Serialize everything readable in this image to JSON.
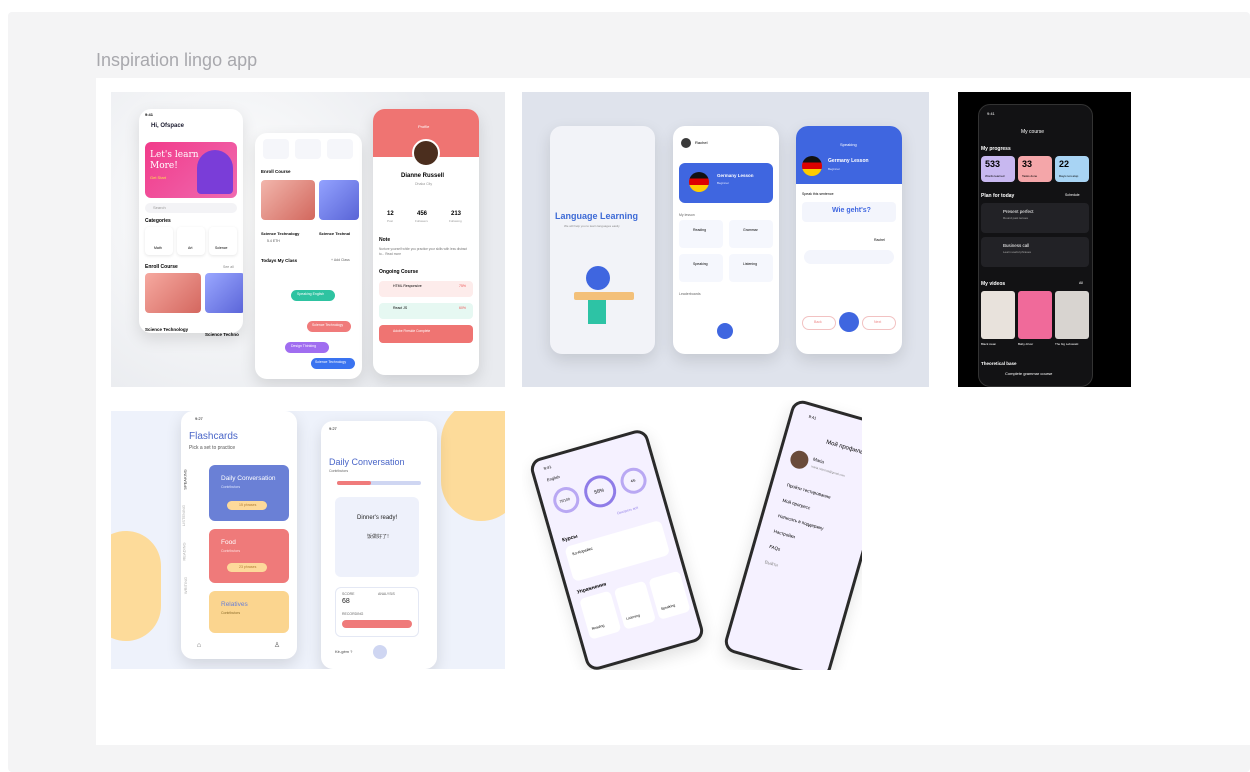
{
  "frame": {
    "title": "Inspiration lingo app"
  },
  "shot1": {
    "greeting": "Hi, Ofspace",
    "time": "9:41",
    "banner_line1": "Let's learn",
    "banner_line2": "More!",
    "banner_cta": "Get Start",
    "search_placeholder": "Search",
    "categories_label": "Categories",
    "cat_math": "Math",
    "cat_art": "Art",
    "cat_science": "Science",
    "enroll_label": "Enroll Course",
    "see_all": "See all",
    "course1": "Science Technology",
    "course2": "Science Techno",
    "course_a": "Science Technology",
    "course_b": "Science Technol",
    "price": "5.4 ETH",
    "todays_class": "Todays My Class",
    "add_class": "+ Add Class",
    "class1": "Speaking English",
    "class2": "Science Technology",
    "class3": "Design Thinking",
    "class4": "Science Technology",
    "profile_label": "Profile",
    "name": "Dianne Russell",
    "location": "Dhaka City",
    "stat1": "12",
    "stat2": "456",
    "stat3": "213",
    "stat1_label": "Post",
    "stat2_label": "Followers",
    "stat3_label": "Following",
    "note_label": "Note",
    "note_text": "Nurture yourself while you practice your skills with less distract to... Read more",
    "ongoing": "Ongoing Course",
    "ongoing1": "HTML Responsive",
    "ongoing2": "React JS",
    "ongoing3": "Adobe Fireside Complete",
    "pct1": "75%",
    "pct2": "60%"
  },
  "shot2": {
    "splash_title": "Language Learning",
    "splash_sub": "We will help you to learn languages easily",
    "user": "Rachel",
    "lesson": "Germany Lesson",
    "level": "Beginner",
    "my_lesson": "My lesson",
    "reading": "Reading",
    "grammar": "Grammar",
    "speaking": "Speaking",
    "listening": "Listening",
    "leaderboards": "Leaderboards",
    "speak_title": "Speaking",
    "speak_lesson": "Germany Lesson",
    "speak_level": "Beginner",
    "speak_prompt": "Speak this sentence",
    "phrase": "Wie geht's?",
    "user2": "Rachel",
    "back_btn": "Back",
    "next_btn": "Next",
    "pct": "35%"
  },
  "shot3": {
    "time": "9:41",
    "title": "My course",
    "progress": "My progress",
    "w1": "533",
    "w2": "33",
    "w3": "22",
    "w1_label": "Words learned",
    "w2_label": "Tasks done",
    "w3_label": "Days non-stop",
    "plan": "Plan for today",
    "schedule": "Schedule",
    "task1": "Present perfect",
    "task1_sub": "Round past tenses",
    "task2": "Business call",
    "task2_sub": "Learn useful phrases",
    "videos": "My videos",
    "all": "All",
    "v1": "Black swan",
    "v2": "Baby driver",
    "v3": "The big Lebowski",
    "theory": "Theoretical base",
    "grammar_course": "Complete grammar course",
    "grammar_sub": "Tenses in one plan"
  },
  "shot4": {
    "time": "9:27",
    "title": "Flashcards",
    "subtitle": "Pick a set to practice",
    "tab1": "SPEAKING",
    "tab2": "LISTENING",
    "tab3": "READING",
    "tab4": "WRITING",
    "card1": "Daily Conversation",
    "card2": "Food",
    "card3": "Relatives",
    "contributors": "Contributors",
    "phrases1": "15 phrases",
    "phrases2": "23 phrases",
    "d_title": "Daily Conversation",
    "d_contrib": "Contributors",
    "quote": "Dinner's ready!",
    "chinese": "饭做好了!",
    "pct": "40%",
    "score_label": "SCORE",
    "analysis_label": "ANALYSIS",
    "score": "68",
    "recording": "RECORDING",
    "mic_text": "Kè-gèm ?"
  },
  "shot5": {
    "time": "9:41",
    "lang": "English",
    "p1": "75/100",
    "p2": "55%",
    "p3": "4/6",
    "p1_label": "Скорость",
    "p2_label": "Ежедневная цель",
    "p3_label": "Навыки",
    "see_all": "Смотреть всё",
    "courses": "Курсы",
    "course": "Ко-Корейкс",
    "exercises": "Упражнения",
    "ex1": "Reading",
    "ex2": "Listening",
    "ex3": "Speaking",
    "time2": "9:41",
    "profile_title": "Мой профиль",
    "user": "Maria",
    "email": "maria.ivanova@gmail.com",
    "m1": "Пройти тестирование",
    "m2": "Мой прогресс",
    "m3": "Написать в поддержку",
    "m4": "Настройки",
    "m5": "FAQs",
    "m6": "Выйти"
  },
  "colors": {
    "accent_blue": "#3f66e0",
    "coral": "#ef6f6f",
    "dark": "#0b0b0d",
    "lavender": "#8f7ce8"
  }
}
